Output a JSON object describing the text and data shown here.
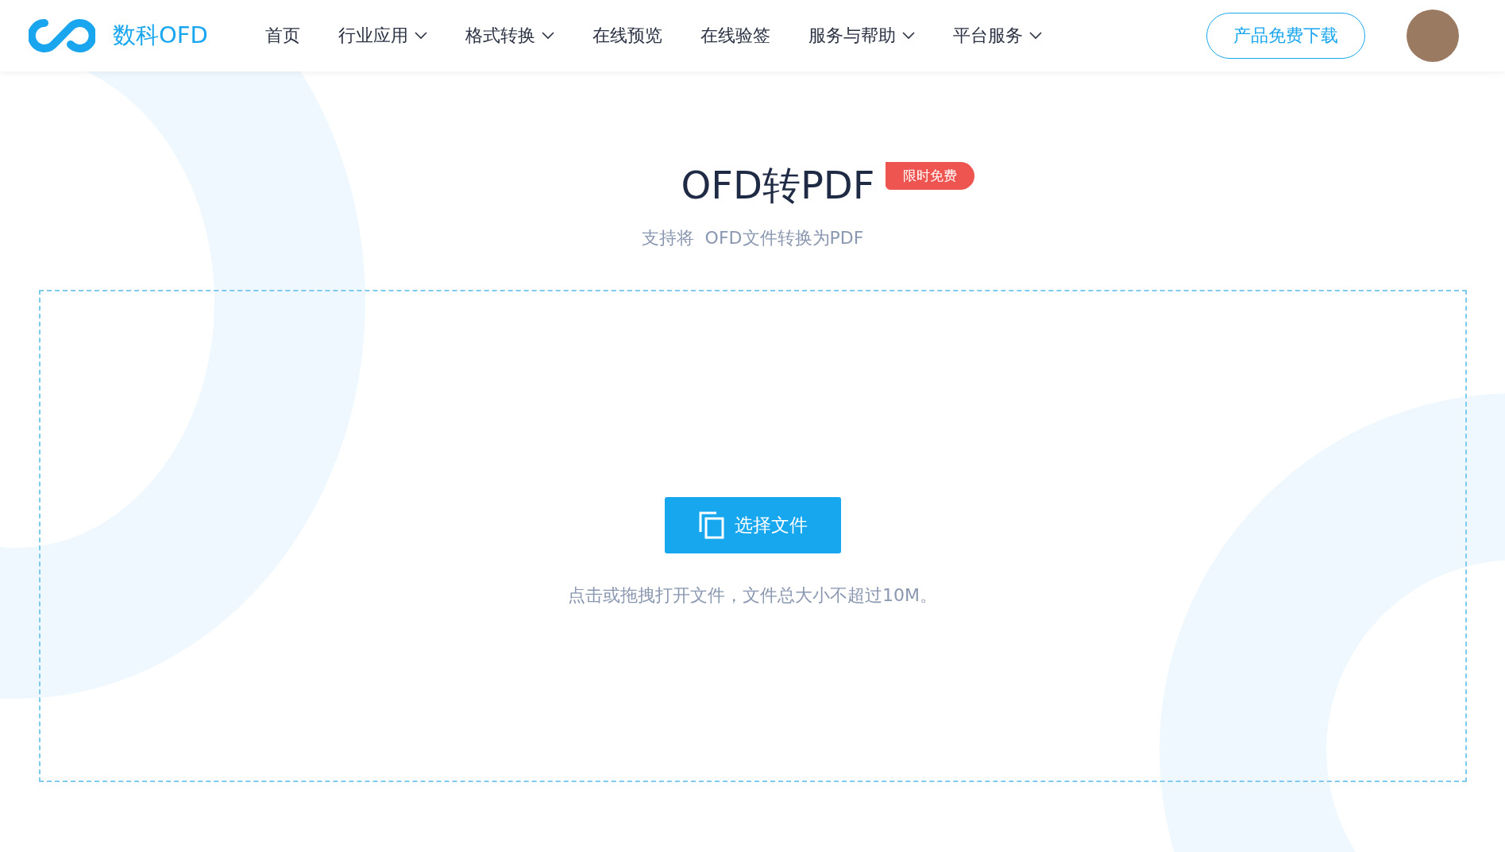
{
  "brand": {
    "name": "数科OFD"
  },
  "nav": [
    {
      "label": "首页",
      "has_menu": false
    },
    {
      "label": "行业应用",
      "has_menu": true
    },
    {
      "label": "格式转换",
      "has_menu": true
    },
    {
      "label": "在线预览",
      "has_menu": false
    },
    {
      "label": "在线验签",
      "has_menu": false
    },
    {
      "label": "服务与帮助",
      "has_menu": true
    },
    {
      "label": "平台服务",
      "has_menu": true
    }
  ],
  "download_button": "产品免费下载",
  "title": "OFD转PDF",
  "badge": "限时免费",
  "subtitle": "支持将  OFD文件转换为PDF",
  "upload": {
    "button": "选择文件",
    "hint": "点击或拖拽打开文件，文件总大小不超过10M。"
  }
}
